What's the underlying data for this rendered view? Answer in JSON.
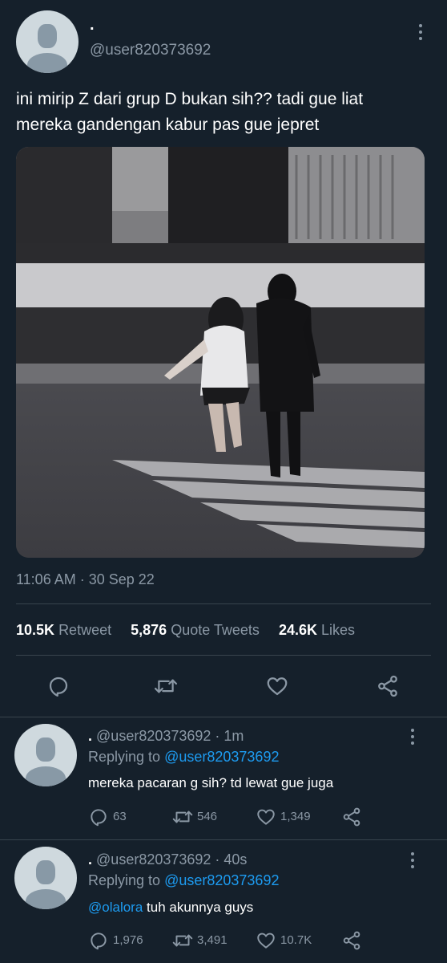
{
  "tweet": {
    "display_name": ".",
    "handle": "@user820373692",
    "text_line1": "ini mirip Z dari grup D bukan sih?? tadi gue liat",
    "text_line2": "mereka gandengan kabur pas gue jepret",
    "timestamp": "11:06 AM · 30 Sep 22",
    "stats": {
      "retweets_count": "10.5K",
      "retweets_label": "Retweet",
      "quotes_count": "5,876",
      "quotes_label": "Quote Tweets",
      "likes_count": "24.6K",
      "likes_label": "Likes"
    },
    "icons": [
      "reply-icon",
      "retweet-icon",
      "like-icon",
      "share-icon"
    ]
  },
  "replies": [
    {
      "display_name": ".",
      "handle_time": "@user820373692 · 1m",
      "replying_prefix": "Replying to",
      "replying_handle": "@user820373692",
      "text_mention": "",
      "text": "mereka pacaran g sih? td lewat gue juga",
      "reply_count": "63",
      "retweet_count": "546",
      "like_count": "1,349"
    },
    {
      "display_name": ".",
      "handle_time": "@user820373692 · 40s",
      "replying_prefix": "Replying to",
      "replying_handle": "@user820373692",
      "text_mention": "@olalora",
      "text": " tuh akunnya guys",
      "reply_count": "1,976",
      "retweet_count": "3,491",
      "like_count": "10.7K"
    }
  ],
  "colors": {
    "background": "#15202b",
    "muted": "#8b98a5",
    "accent": "#1d9bf0",
    "divider": "#38444d"
  }
}
